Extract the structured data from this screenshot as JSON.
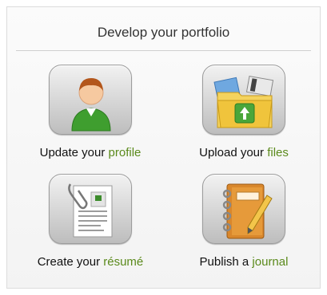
{
  "panel": {
    "title": "Develop your portfolio",
    "accent_color": "#5b8a1c",
    "tiles": [
      {
        "icon": "user-profile-icon",
        "prefix": "Update your ",
        "highlight": "profile"
      },
      {
        "icon": "folder-upload-icon",
        "prefix": "Upload your ",
        "highlight": "files"
      },
      {
        "icon": "resume-document-icon",
        "prefix": "Create your ",
        "highlight": "résumé"
      },
      {
        "icon": "journal-notebook-icon",
        "prefix": "Publish a ",
        "highlight": "journal"
      }
    ]
  }
}
